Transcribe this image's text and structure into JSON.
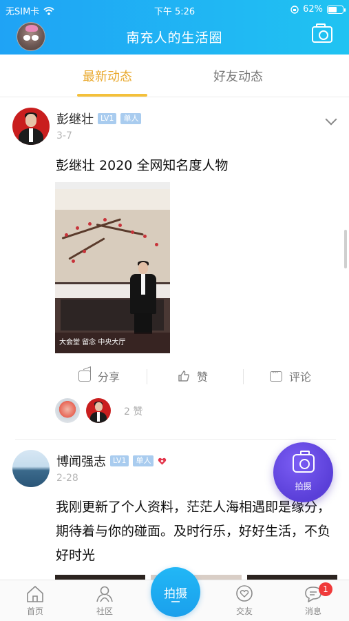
{
  "status_bar": {
    "carrier": "无SIM卡",
    "time": "下午 5:26",
    "battery_percent_label": "62%",
    "battery_level": 0.62
  },
  "header": {
    "title": "南充人的生活圈",
    "avatar_icon": "avatar-icon",
    "camera_icon": "camera-icon"
  },
  "tabs": [
    {
      "label": "最新动态",
      "active": true
    },
    {
      "label": "好友动态",
      "active": false
    }
  ],
  "posts": [
    {
      "author": "彭继壮",
      "level": "LV1",
      "status": "单人",
      "date": "3-7",
      "text": "彭继壮 2020 全网知名度人物",
      "photo_caption": "大会堂  留念  中央大厅",
      "actions": {
        "share": "分享",
        "like": "赞",
        "comment": "评论"
      },
      "likes_label": "2 赞"
    },
    {
      "author": "博闻强志",
      "level": "LV1",
      "status": "单人",
      "date": "2-28",
      "text": "我刚更新了个人资料，茫茫人海相遇即是缘分，期待着与你的碰面。及时行乐，好好生活，不负好时光"
    }
  ],
  "fab": {
    "label": "拍摄"
  },
  "bottom_nav": {
    "home": "首页",
    "community": "社区",
    "center": "拍摄",
    "friends": "交友",
    "messages": "消息",
    "messages_badge": "1"
  },
  "colors": {
    "header_gradient_start": "#1fa3f5",
    "header_gradient_end": "#20c3f2",
    "active_tab": "#e9a82b",
    "fab": "#5a3fd8",
    "badge": "#f03a3a"
  }
}
